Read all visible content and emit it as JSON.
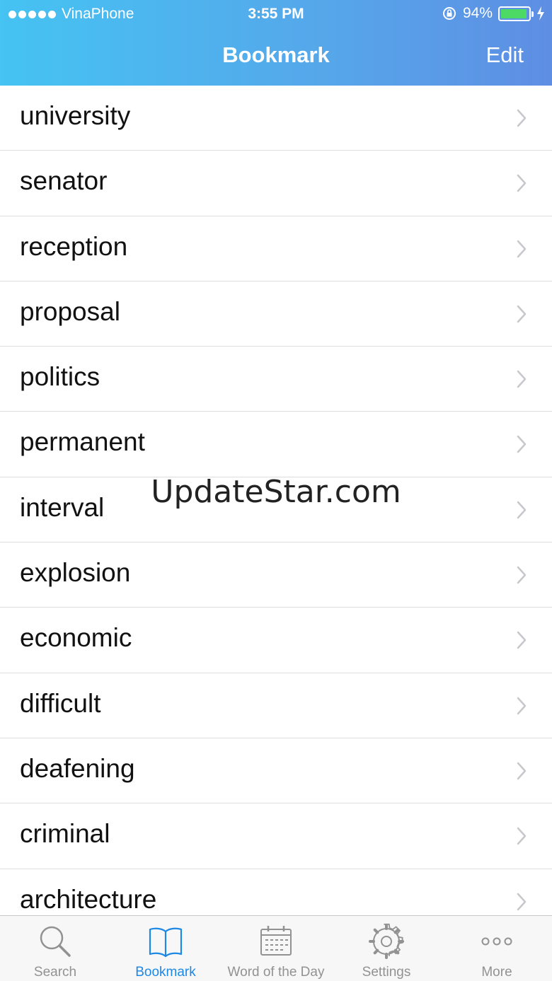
{
  "status_bar": {
    "carrier": "VinaPhone",
    "time": "3:55 PM",
    "battery_percent": "94%",
    "battery_level": 0.94
  },
  "nav": {
    "title": "Bookmark",
    "edit_label": "Edit"
  },
  "bookmarks": [
    "university",
    "senator",
    "reception",
    "proposal",
    "politics",
    "permanent",
    "interval",
    "explosion",
    "economic",
    "difficult",
    "deafening",
    "criminal",
    "architecture"
  ],
  "watermark": "UpdateStar.com",
  "tabs": [
    {
      "label": "Search",
      "icon": "search-icon"
    },
    {
      "label": "Bookmark",
      "icon": "book-icon"
    },
    {
      "label": "Word of the Day",
      "icon": "calendar-icon"
    },
    {
      "label": "Settings",
      "icon": "gear-icon"
    },
    {
      "label": "More",
      "icon": "more-icon"
    }
  ],
  "colors": {
    "header_start": "#45c3f2",
    "header_end": "#5e8ee3",
    "active_tab": "#1e88e5",
    "inactive_tab": "#929292",
    "battery": "#4cd964"
  }
}
